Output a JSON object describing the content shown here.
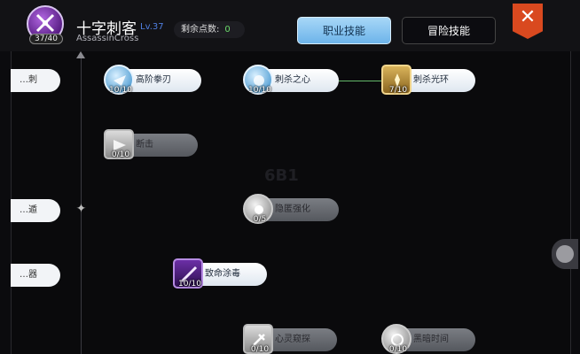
{
  "header": {
    "class_name": "十字刺客",
    "class_level": "Lv.37",
    "class_name_en": "AssassinCross",
    "class_badge": "37/40",
    "points_label": "剩余点数:",
    "points_value": "0",
    "tab_job": "职业技能",
    "tab_adventure": "冒险技能",
    "close": "✕"
  },
  "background_text": "6B1",
  "edge_pills": [
    {
      "label": "…刺"
    },
    {
      "label": "…遁"
    },
    {
      "label": "…器"
    }
  ],
  "skills": [
    {
      "name": "高阶拳刃",
      "level": "10/10",
      "state": "active"
    },
    {
      "name": "刺杀之心",
      "level": "10/10",
      "state": "active"
    },
    {
      "name": "刺杀光环",
      "level": "7/10",
      "state": "active"
    },
    {
      "name": "断击",
      "level": "0/10",
      "state": "locked"
    },
    {
      "name": "隐匿强化",
      "level": "0/5",
      "state": "locked"
    },
    {
      "name": "致命涂毒",
      "level": "10/10",
      "state": "active"
    },
    {
      "name": "心灵窥探",
      "level": "0/10",
      "state": "locked"
    },
    {
      "name": "黑暗时间",
      "level": "0/10",
      "state": "locked"
    }
  ],
  "colors": {
    "tab_active": "#6db4ea",
    "close": "#d9491f",
    "level_accent": "#4f7ee0",
    "points_accent": "#6bd96b",
    "connector": "#63b86a"
  }
}
